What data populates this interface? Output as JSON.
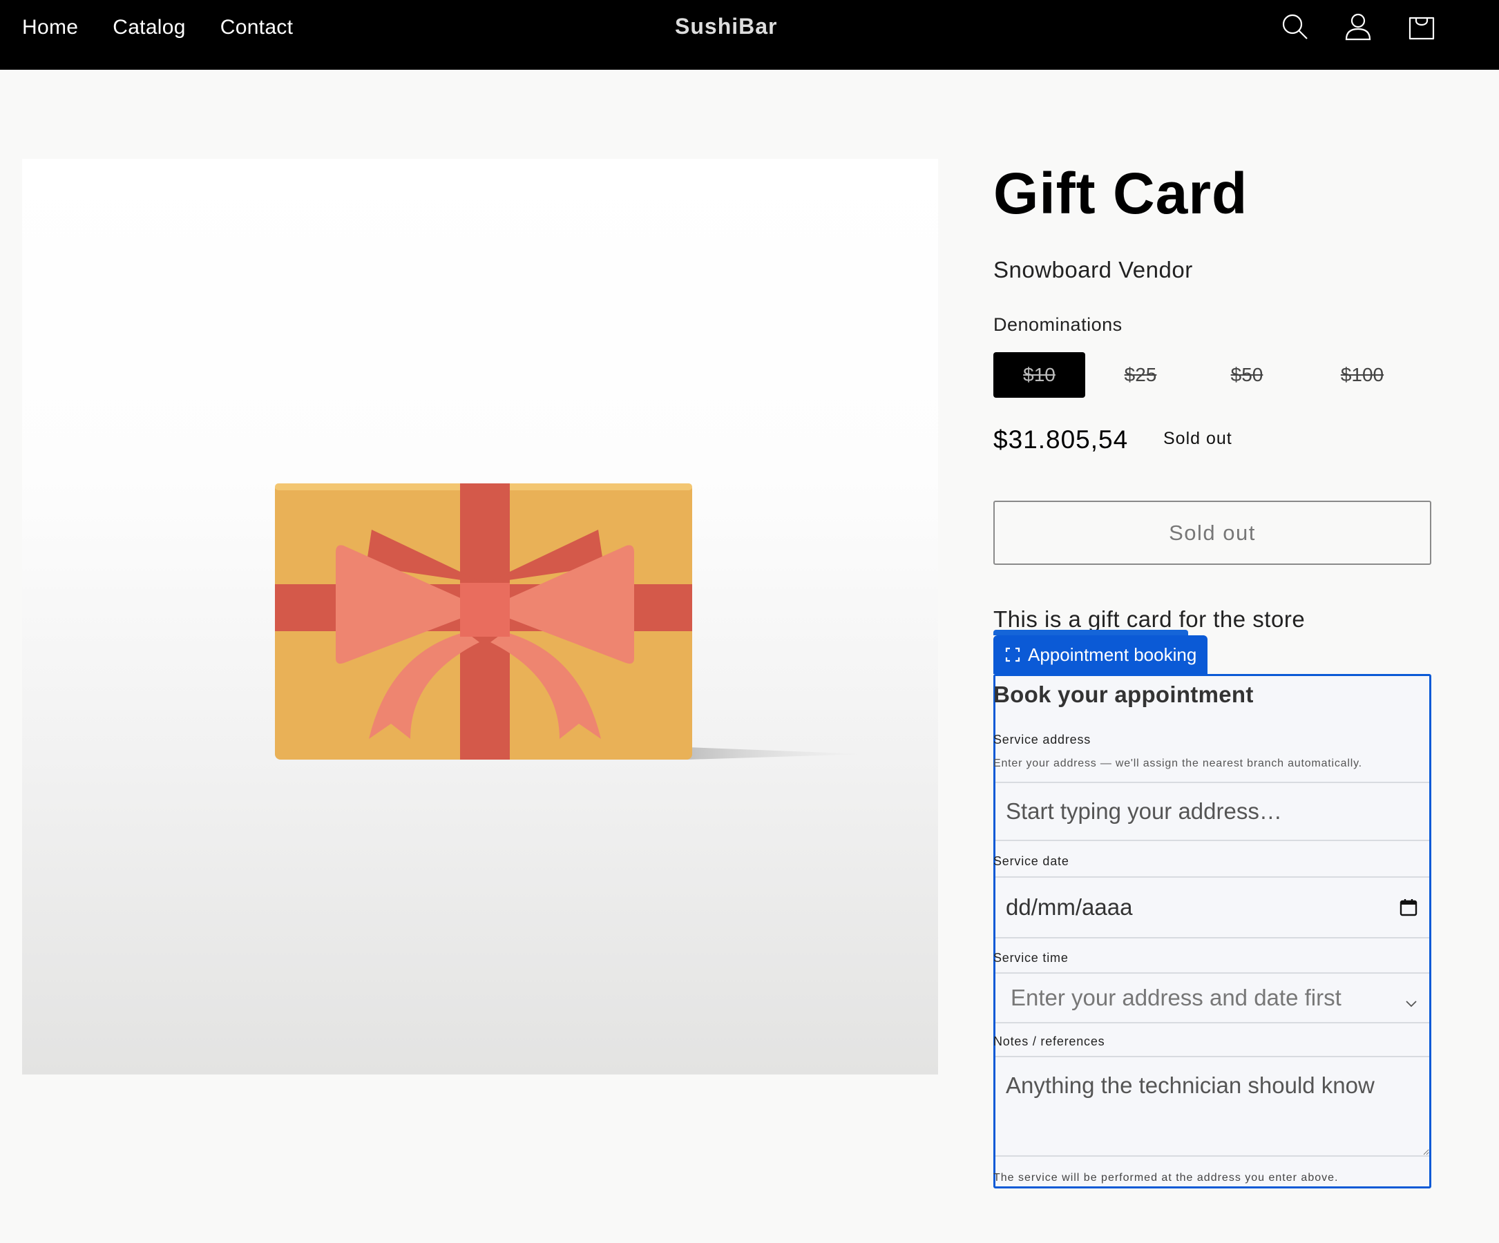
{
  "header": {
    "nav": [
      "Home",
      "Catalog",
      "Contact"
    ],
    "brand": "SushiBar",
    "icons": [
      "search-icon",
      "account-icon",
      "cart-icon"
    ],
    "background_color": "#000000"
  },
  "product": {
    "title": "Gift Card",
    "vendor": "Snowboard Vendor",
    "denominations_label": "Denominations",
    "denominations": [
      "$10",
      "$25",
      "$50",
      "$100"
    ],
    "selected_denomination": "$10",
    "price": "$31.805,54",
    "badge": "Sold out",
    "button_label": "Sold out",
    "description": "This is a gift card for the store"
  },
  "booking": {
    "tab_label": "Appointment booking",
    "title": "Book your appointment",
    "address_label": "Service address",
    "address_help": "Enter your address — we'll assign the nearest branch automatically.",
    "address_placeholder": "Start typing your address…",
    "date_label": "Service date",
    "date_placeholder": "dd/mm/aaaa",
    "time_label": "Service time",
    "time_placeholder": "Enter your address and date first",
    "notes_label": "Notes / references",
    "notes_placeholder": "Anything the technician should know",
    "footnote": "The service will be performed at the address you enter above.",
    "accent_color": "#0b5ad6"
  }
}
